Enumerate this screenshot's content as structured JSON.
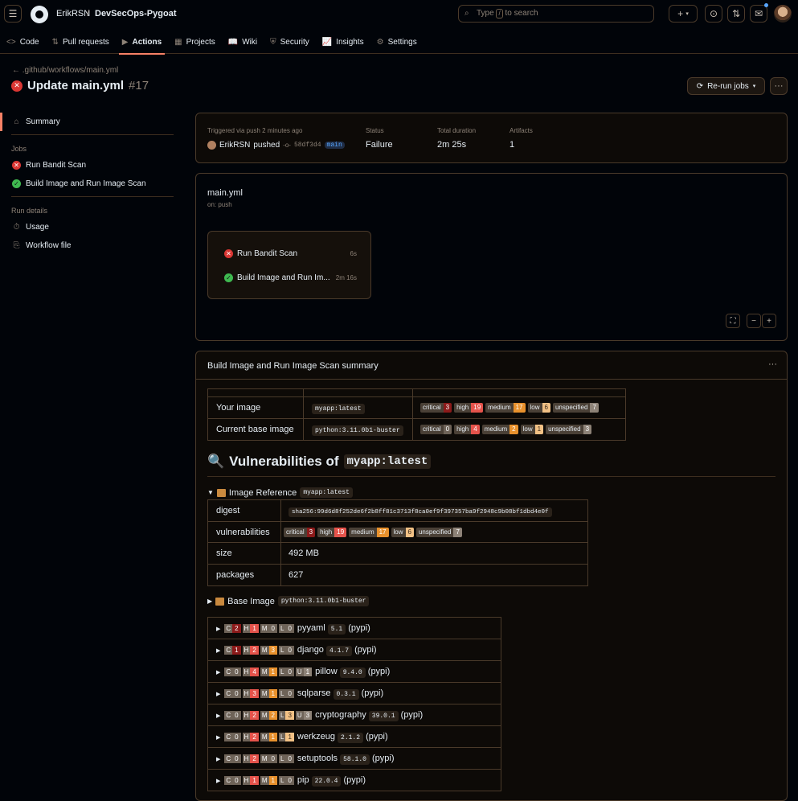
{
  "header": {
    "owner": "ErikRSN",
    "separator": "/",
    "repo": "DevSecOps-Pygoat",
    "search_pre": "Type",
    "search_key": "/",
    "search_post": "to search",
    "plus": "+"
  },
  "tabs": [
    {
      "label": "Code",
      "icon": "<>"
    },
    {
      "label": "Pull requests",
      "icon": "⇅"
    },
    {
      "label": "Actions",
      "icon": "▶"
    },
    {
      "label": "Projects",
      "icon": "▦"
    },
    {
      "label": "Wiki",
      "icon": "📖"
    },
    {
      "label": "Security",
      "icon": "⛨"
    },
    {
      "label": "Insights",
      "icon": "📈"
    },
    {
      "label": "Settings",
      "icon": "⚙"
    }
  ],
  "run": {
    "back_link": ".github/workflows/main.yml",
    "title": "Update main.yml",
    "number": "#17",
    "rerun_label": "Re-run jobs"
  },
  "sidebar": {
    "summary": "Summary",
    "jobs_heading": "Jobs",
    "jobs": [
      "Run Bandit Scan",
      "Build Image and Run Image Scan"
    ],
    "run_details_heading": "Run details",
    "details": [
      "Usage",
      "Workflow file"
    ]
  },
  "meta": {
    "triggered": "Triggered via push 2 minutes ago",
    "user": "ErikRSN",
    "pushed": "pushed",
    "sha": "58df3d4",
    "branch": "main",
    "status_label": "Status",
    "status_value": "Failure",
    "duration_label": "Total duration",
    "duration_value": "2m 25s",
    "artifacts_label": "Artifacts",
    "artifacts_value": "1"
  },
  "workflow": {
    "name": "main.yml",
    "trigger": "on: push",
    "jobs": [
      {
        "name": "Run Bandit Scan",
        "duration": "6s"
      },
      {
        "name": "Build Image and Run Im...",
        "duration": "2m 16s"
      }
    ]
  },
  "summary": {
    "title": "Build Image and Run Image Scan summary",
    "your_image_label": "Your image",
    "your_image": "myapp:latest",
    "base_image_label": "Current base image",
    "base_image": "python:3.11.0b1-buster",
    "your_counts": {
      "critical": "3",
      "high": "19",
      "medium": "17",
      "low": "6",
      "unspecified": "7"
    },
    "base_counts": {
      "critical": "0",
      "high": "4",
      "medium": "2",
      "low": "1",
      "unspecified": "3"
    },
    "badge_labels": {
      "critical": "critical",
      "high": "high",
      "medium": "medium",
      "low": "low",
      "unspecified": "unspecified"
    },
    "vuln_heading_icon": "🔍",
    "vuln_heading": "Vulnerabilities of",
    "vuln_heading_code": "myapp:latest",
    "image_ref_label": "Image Reference",
    "image_ref_code": "myapp:latest",
    "digest_label": "digest",
    "digest": "sha256:99d6d8f252de6f2b8ff81c3713f8ca0ef9f397357ba9f2948c9b08bf1dbd4e0f",
    "vulnerabilities_label": "vulnerabilities",
    "size_label": "size",
    "size": "492 MB",
    "packages_label": "packages",
    "packages": "627",
    "base_image_section_label": "Base Image",
    "base_image_section_code": "python:3.11.0b1-buster"
  },
  "packages": [
    {
      "c": "2",
      "h": "1",
      "m": "0",
      "l": "0",
      "u": "",
      "name": "pyyaml",
      "version": "5.1",
      "eco": "(pypi)"
    },
    {
      "c": "1",
      "h": "2",
      "m": "3",
      "l": "0",
      "u": "",
      "name": "django",
      "version": "4.1.7",
      "eco": "(pypi)"
    },
    {
      "c": "0",
      "h": "4",
      "m": "1",
      "l": "0",
      "u": "1",
      "name": "pillow",
      "version": "9.4.0",
      "eco": "(pypi)"
    },
    {
      "c": "0",
      "h": "3",
      "m": "1",
      "l": "0",
      "u": "",
      "name": "sqlparse",
      "version": "0.3.1",
      "eco": "(pypi)"
    },
    {
      "c": "0",
      "h": "2",
      "m": "2",
      "l": "3",
      "u": "3",
      "name": "cryptography",
      "version": "39.0.1",
      "eco": "(pypi)"
    },
    {
      "c": "0",
      "h": "2",
      "m": "1",
      "l": "1",
      "u": "",
      "name": "werkzeug",
      "version": "2.1.2",
      "eco": "(pypi)"
    },
    {
      "c": "0",
      "h": "2",
      "m": "0",
      "l": "0",
      "u": "",
      "name": "setuptools",
      "version": "58.1.0",
      "eco": "(pypi)"
    },
    {
      "c": "0",
      "h": "1",
      "m": "1",
      "l": "0",
      "u": "",
      "name": "pip",
      "version": "22.0.4",
      "eco": "(pypi)"
    }
  ],
  "mini_keys": {
    "c": "C",
    "h": "H",
    "m": "M",
    "l": "L",
    "u": "U"
  },
  "colors": {
    "accent": "#f78166",
    "failure": "#da3633",
    "success": "#3fb950",
    "critical": "#8c1a1a",
    "high": "#e5534b",
    "medium": "#e8912d",
    "low": "#f2c185",
    "unspecified": "#8d8277"
  }
}
